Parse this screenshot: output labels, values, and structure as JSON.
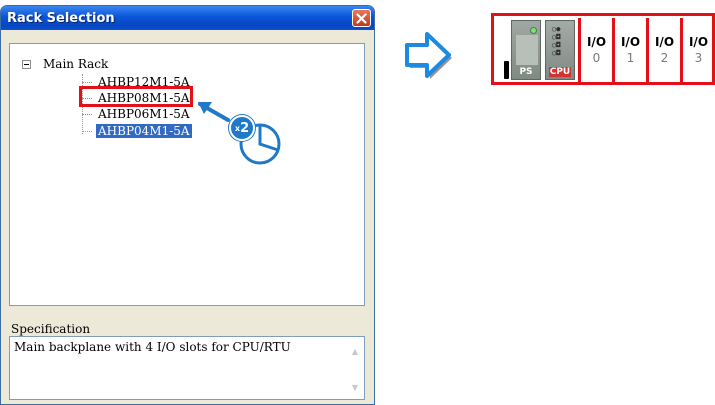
{
  "window": {
    "title": "Rack Selection"
  },
  "tree": {
    "root_label": "Main Rack",
    "items": [
      {
        "label": "AHBP12M1-5A"
      },
      {
        "label": "AHBP08M1-5A"
      },
      {
        "label": "AHBP06M1-5A"
      },
      {
        "label": "AHBP04M1-5A",
        "selected": true
      }
    ]
  },
  "specification": {
    "label": "Specification",
    "text": "Main backplane with 4 I/O slots for CPU/RTU"
  },
  "double_click": {
    "badge": "2",
    "badge_prefix": "x"
  },
  "rack": {
    "ps_label": "PS",
    "cpu_label": "CPU",
    "io_label": "I/O",
    "slots": [
      "0",
      "1",
      "2",
      "3"
    ]
  },
  "colors": {
    "highlight": "#e3101a",
    "accent_blue": "#1f78c8",
    "selection": "#316ac5",
    "titlebar": "#0a55d8"
  }
}
